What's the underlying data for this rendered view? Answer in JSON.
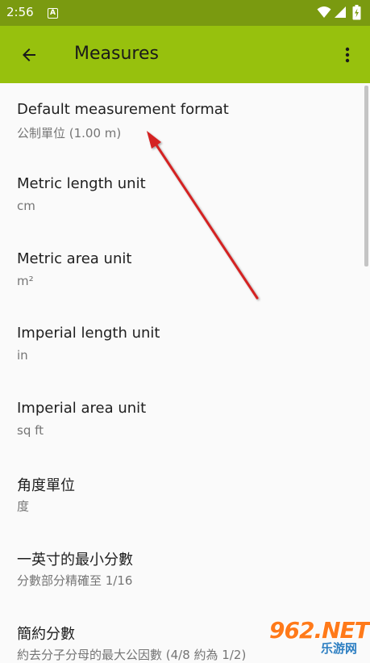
{
  "status_bar": {
    "time": "2:56",
    "notification_letter": "A"
  },
  "app_bar": {
    "title": "Measures"
  },
  "settings": [
    {
      "title": "Default measurement format",
      "summary": "公制單位 (1.00 m)"
    },
    {
      "title": "Metric length unit",
      "summary": "cm"
    },
    {
      "title": "Metric area unit",
      "summary": "m²"
    },
    {
      "title": "Imperial length unit",
      "summary": "in"
    },
    {
      "title": "Imperial area unit",
      "summary": "sq ft"
    },
    {
      "title": "角度單位",
      "summary": "度"
    },
    {
      "title": "一英寸的最小分數",
      "summary": "分數部分精確至 1/16"
    },
    {
      "title": "簡約分數",
      "summary": "約去分子分母的最大公因數 (4/8 約為 1/2)"
    }
  ],
  "watermark": {
    "brand": "962.NET",
    "sub": "乐游网"
  },
  "colors": {
    "status_bar": "#7a9a10",
    "app_bar": "#97c10d",
    "annotation_arrow": "#d42020",
    "watermark_orange": "#ff7a1a",
    "watermark_blue": "#2d7fc2"
  },
  "icons": {
    "back": "arrow-left-icon",
    "overflow": "more-vert-icon",
    "wifi": "wifi-icon",
    "signal": "signal-icon",
    "battery": "battery-charging-icon"
  }
}
